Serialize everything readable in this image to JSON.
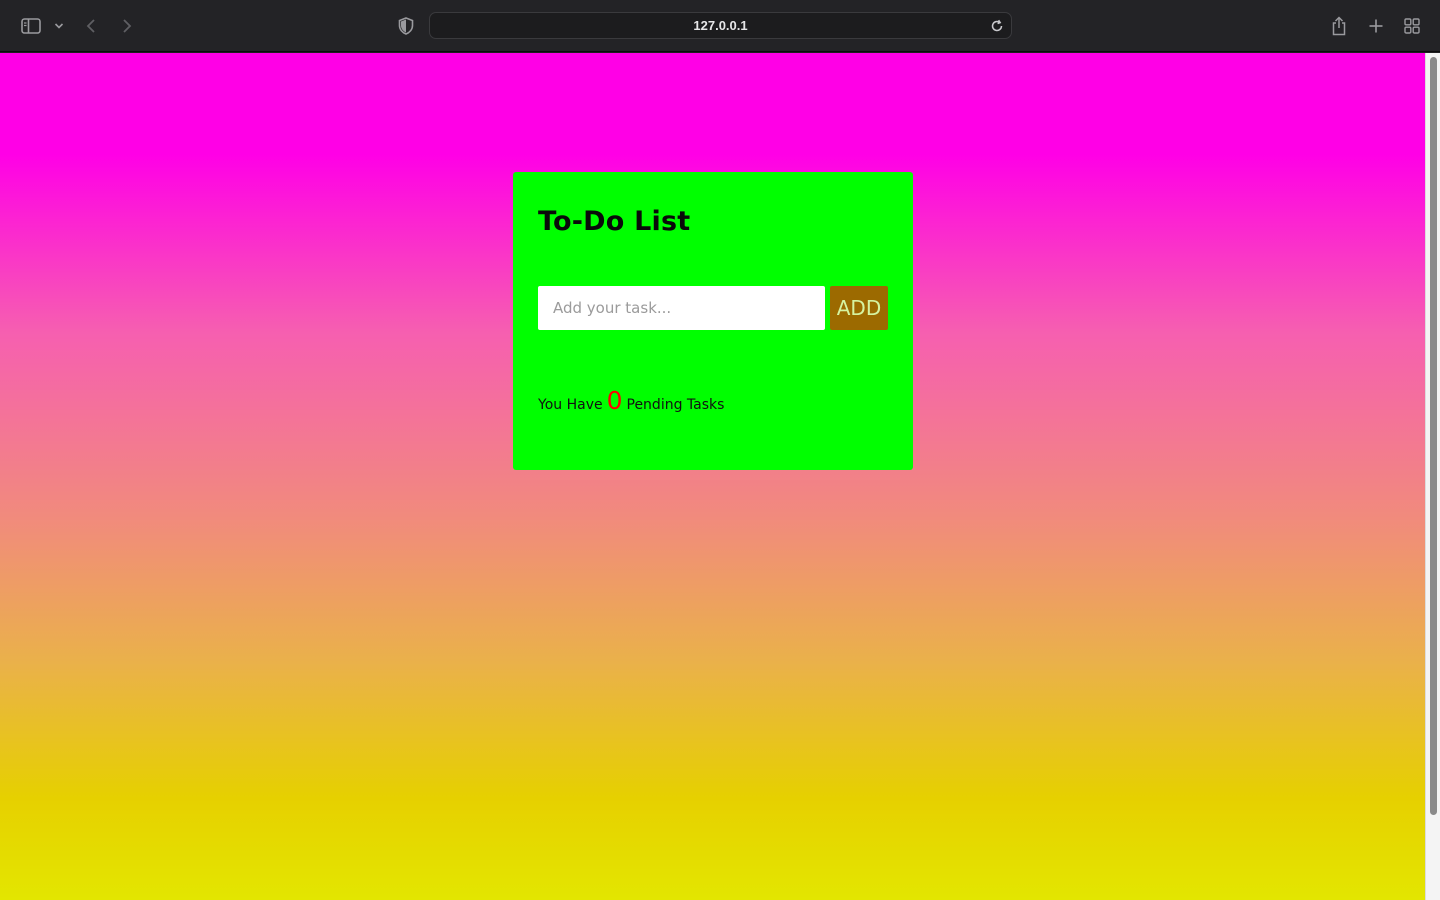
{
  "browser": {
    "url": "127.0.0.1",
    "icons": [
      "sidebar-icon",
      "chevron-down-icon",
      "back-icon",
      "forward-icon",
      "shield-icon",
      "reload-icon",
      "share-icon",
      "new-tab-icon",
      "tab-overview-icon"
    ]
  },
  "app": {
    "title": "To-Do List",
    "input": {
      "placeholder": "Add your task...",
      "value": ""
    },
    "add_label": "ADD",
    "status": {
      "prefix": "You Have",
      "count": "0",
      "suffix": "Pending Tasks"
    }
  },
  "colors": {
    "card_background": "#00ff00",
    "add_button": "#9c6a00",
    "add_button_text": "#d5f3a0",
    "count_text": "#ff0000",
    "gradient_top": "#ff00e6",
    "gradient_bottom": "#e3e600"
  }
}
